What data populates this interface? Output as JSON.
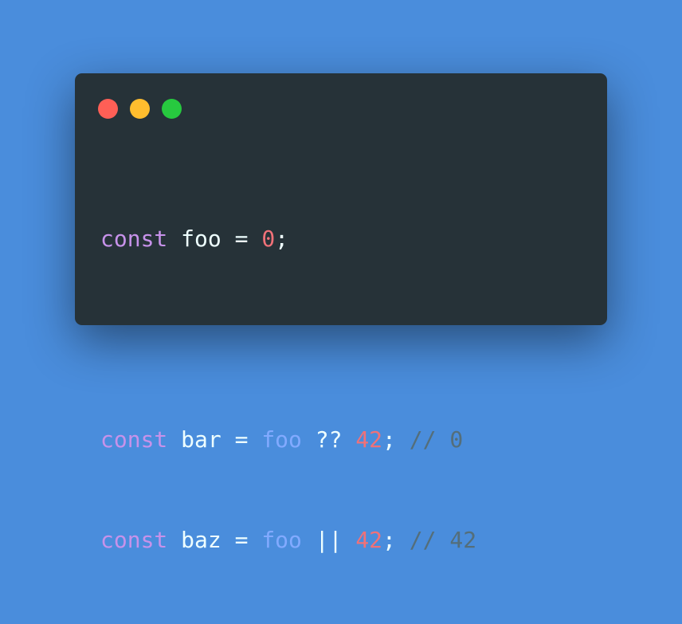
{
  "window": {
    "controls": [
      {
        "name": "close",
        "color": "#ff5f56"
      },
      {
        "name": "minimize",
        "color": "#ffbd2e"
      },
      {
        "name": "maximize",
        "color": "#27c93f"
      }
    ]
  },
  "code": {
    "lines": [
      {
        "kw": "const",
        "id": "foo",
        "eq": "=",
        "num": "0",
        "semi": ";"
      },
      {},
      {
        "kw": "const",
        "id": "bar",
        "eq": "=",
        "ref": "foo",
        "op": "??",
        "num": "42",
        "semi": ";",
        "comment": "// 0"
      },
      {
        "kw": "const",
        "id": "baz",
        "eq": "=",
        "ref": "foo",
        "op": "||",
        "num": "42",
        "semi": ";",
        "comment": "// 42"
      }
    ]
  }
}
